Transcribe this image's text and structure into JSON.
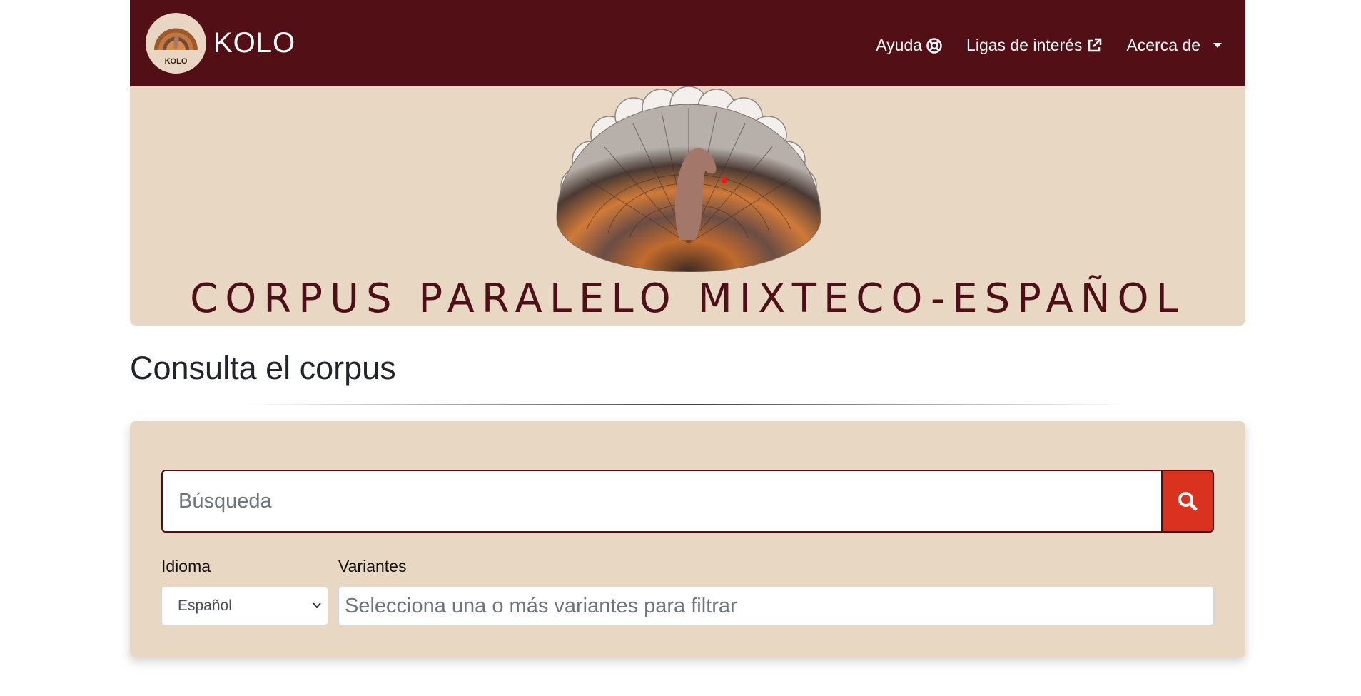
{
  "navbar": {
    "brand_name": "KOLO",
    "logo_text": "KOLO",
    "links": [
      {
        "label": "Ayuda",
        "icon": "lifebuoy-icon"
      },
      {
        "label": "Ligas de interés",
        "icon": "external-link-icon"
      },
      {
        "label": "Acerca de",
        "icon": "caret-down-icon"
      }
    ]
  },
  "banner": {
    "title": "CORPUS PARALELO MIXTECO-ESPAÑOL",
    "image": "turkey-illustration"
  },
  "main": {
    "heading": "Consulta el corpus"
  },
  "search": {
    "placeholder": "Búsqueda",
    "button_icon": "search-icon",
    "language_label": "Idioma",
    "language_selected": "Español",
    "variants_label": "Variantes",
    "variants_placeholder": "Selecciona una o más variantes para filtrar"
  },
  "colors": {
    "navbar_bg": "#530f16",
    "banner_bg": "#e8d7c3",
    "search_button": "#d9321f",
    "title_text": "#4f0f18"
  }
}
